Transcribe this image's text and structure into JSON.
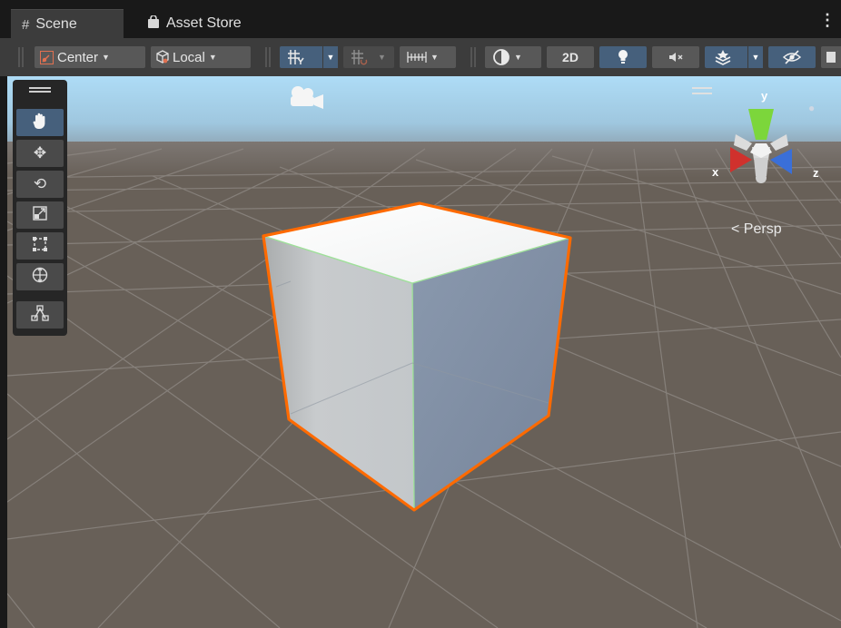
{
  "tabs": [
    {
      "icon": "#",
      "label": "Scene",
      "active": true
    },
    {
      "icon": "bag",
      "label": "Asset Store",
      "active": false
    }
  ],
  "toolbar": {
    "pivot_label": "Center",
    "space_label": "Local",
    "twod_label": "2D"
  },
  "tools": [
    "hand-tool",
    "move-tool",
    "rotate-tool",
    "scale-tool",
    "rect-tool",
    "transform-tool",
    "custom-editor-tool"
  ],
  "gizmo": {
    "y_label": "y",
    "x_label": "x",
    "z_label": "z",
    "projection_label": "Persp"
  },
  "colors": {
    "selection_outline": "#ff6a00",
    "x_axis": "#d0312d",
    "y_axis": "#7cd63b",
    "z_axis": "#3a6fd8",
    "active_tool": "#46607c",
    "ground": "#686058"
  }
}
